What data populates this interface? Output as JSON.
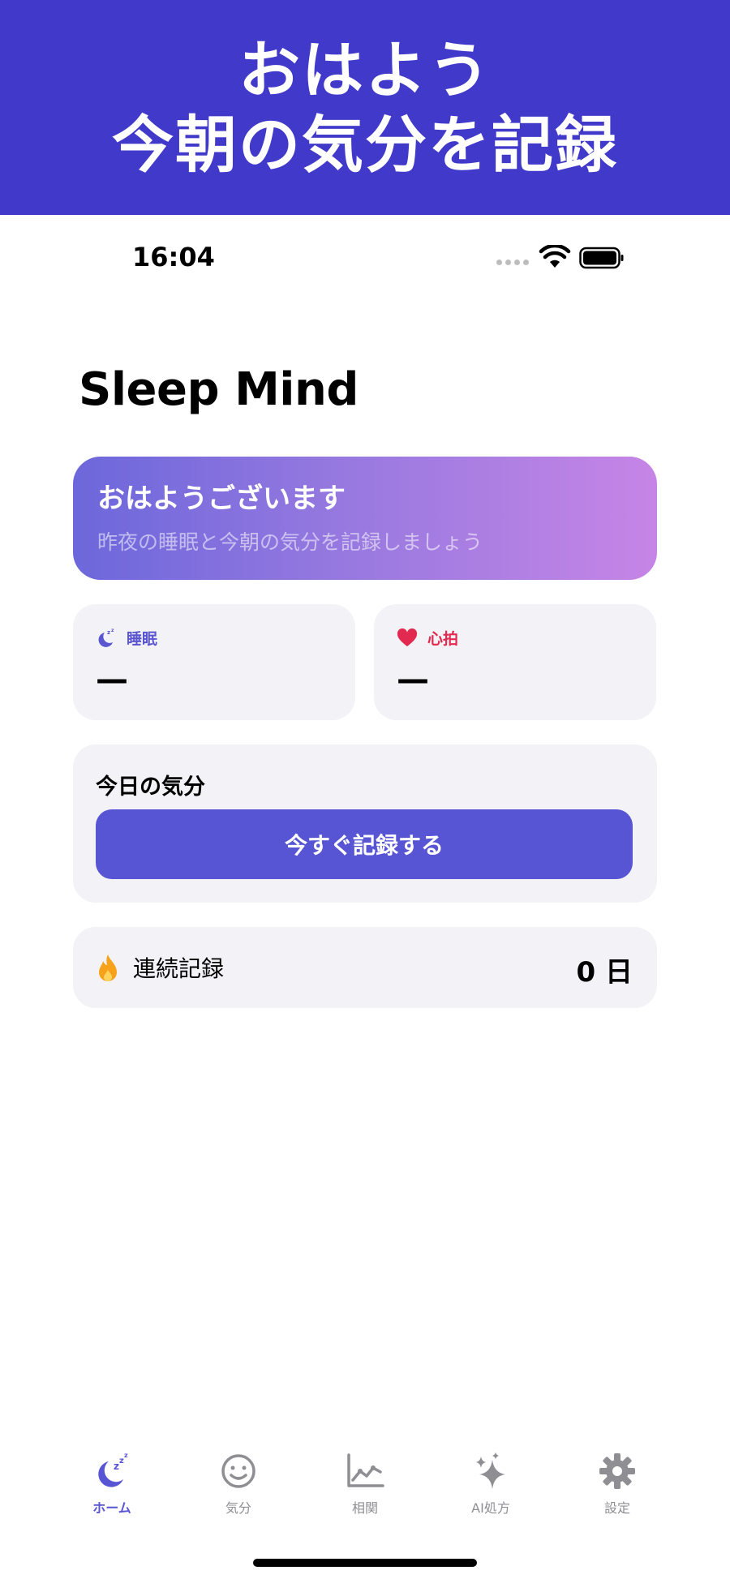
{
  "promo": {
    "line1": "おはよう",
    "line2": "今朝の気分を記録"
  },
  "status_bar": {
    "time": "16:04"
  },
  "app": {
    "title": "Sleep Mind"
  },
  "greeting": {
    "title": "おはようございます",
    "subtitle": "昨夜の睡眠と今朝の気分を記録しましょう"
  },
  "stats": {
    "sleep": {
      "label": "睡眠",
      "value": "—",
      "icon": "moon-zzz-icon"
    },
    "heart": {
      "label": "心拍",
      "value": "—",
      "icon": "heart-icon"
    }
  },
  "mood": {
    "title": "今日の気分",
    "button_label": "今すぐ記録する"
  },
  "streak": {
    "label": "連続記録",
    "value": "0 日",
    "icon": "fire-icon"
  },
  "tabs": [
    {
      "label": "ホーム",
      "icon": "moon-zzz-icon",
      "active": true
    },
    {
      "label": "気分",
      "icon": "smiley-icon",
      "active": false
    },
    {
      "label": "相関",
      "icon": "chart-icon",
      "active": false
    },
    {
      "label": "AI処方",
      "icon": "sparkles-icon",
      "active": false
    },
    {
      "label": "設定",
      "icon": "gear-icon",
      "active": false
    }
  ],
  "colors": {
    "banner": "#4039c9",
    "accent": "#5855d4",
    "heart": "#e2294f",
    "fire": "#f7a21b",
    "card_bg": "#f2f2f7",
    "gradient_start": "#6c67db",
    "gradient_end": "#c685e6"
  }
}
